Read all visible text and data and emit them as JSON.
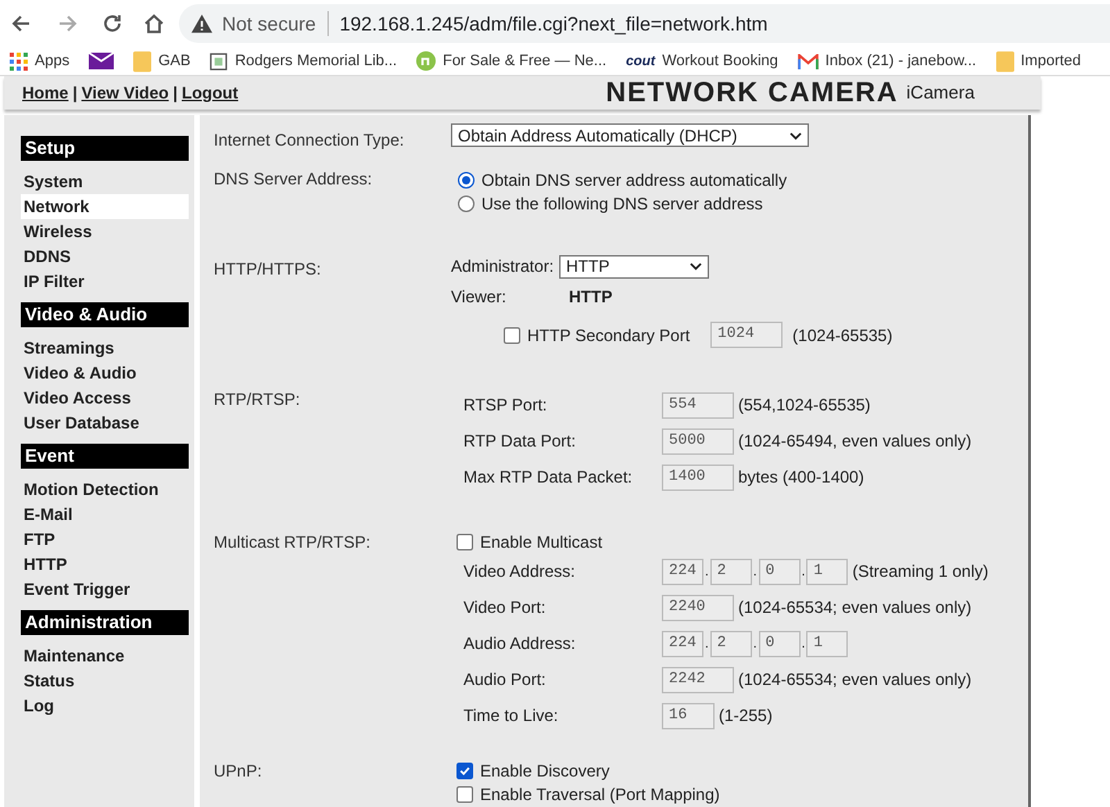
{
  "browser": {
    "security": "Not secure",
    "url": "192.168.1.245/adm/file.cgi?next_file=network.htm"
  },
  "bookmarks": [
    {
      "kind": "apps",
      "label": "Apps"
    },
    {
      "kind": "mail"
    },
    {
      "kind": "folder",
      "label": "GAB"
    },
    {
      "kind": "page",
      "label": "Rodgers Memorial Lib..."
    },
    {
      "kind": "circle",
      "label": "For Sale & Free — Ne..."
    },
    {
      "kind": "logo_text",
      "icon_text": "cout",
      "label": "Workout Booking"
    },
    {
      "kind": "gmail",
      "label": "Inbox (21) - janebow..."
    },
    {
      "kind": "folder",
      "label": "Imported"
    }
  ],
  "header": {
    "nav": [
      "Home",
      "View Video",
      "Logout"
    ],
    "separator": "|",
    "title": "NETWORK CAMERA",
    "subtitle": "iCamera"
  },
  "sidebar": [
    {
      "title": "Setup",
      "items": [
        {
          "label": "System",
          "selected": false
        },
        {
          "label": "Network",
          "selected": true
        },
        {
          "label": "Wireless",
          "selected": false
        },
        {
          "label": "DDNS",
          "selected": false
        },
        {
          "label": "IP Filter",
          "selected": false
        }
      ]
    },
    {
      "title": "Video & Audio",
      "items": [
        {
          "label": "Streamings",
          "selected": false
        },
        {
          "label": "Video & Audio",
          "selected": false
        },
        {
          "label": "Video Access",
          "selected": false
        },
        {
          "label": "User Database",
          "selected": false
        }
      ]
    },
    {
      "title": "Event",
      "items": [
        {
          "label": "Motion Detection",
          "selected": false
        },
        {
          "label": "E-Mail",
          "selected": false
        },
        {
          "label": "FTP",
          "selected": false
        },
        {
          "label": "HTTP",
          "selected": false
        },
        {
          "label": "Event Trigger",
          "selected": false
        }
      ]
    },
    {
      "title": "Administration",
      "items": [
        {
          "label": "Maintenance",
          "selected": false
        },
        {
          "label": "Status",
          "selected": false
        },
        {
          "label": "Log",
          "selected": false
        }
      ]
    }
  ],
  "sections": [
    {
      "label": "Internet Connection Type:",
      "controls": [
        {
          "kind": "select",
          "value": "Obtain Address Automatically (DHCP)"
        }
      ]
    },
    {
      "label": "DNS Server Address:",
      "controls": [
        {
          "kind": "radio",
          "label": "Obtain DNS server address automatically",
          "selected": true
        },
        {
          "kind": "radio",
          "label": "Use the following DNS server address",
          "selected": false
        }
      ]
    },
    {
      "label": "HTTP/HTTPS:",
      "controls": [
        {
          "kind": "labeled_select",
          "label": "Administrator:",
          "value": "HTTP"
        },
        {
          "kind": "labeled_text",
          "label": "Viewer:",
          "value": "HTTP"
        },
        {
          "kind": "check_field",
          "label": "HTTP Secondary Port",
          "checked": false,
          "value": "1024",
          "hint": "(1024-65535)"
        }
      ]
    },
    {
      "label": "RTP/RTSP:",
      "controls": [
        {
          "kind": "field",
          "label": "RTSP Port:",
          "value": "554",
          "hint": "(554,1024-65535)"
        },
        {
          "kind": "field",
          "label": "RTP Data Port:",
          "value": "5000",
          "hint": "(1024-65494, even values only)"
        },
        {
          "kind": "field",
          "label": "Max RTP Data Packet:",
          "value": "1400",
          "hint": "bytes (400-1400)"
        }
      ]
    },
    {
      "label": "Multicast RTP/RTSP:",
      "controls": [
        {
          "kind": "checkbox",
          "label": "Enable Multicast",
          "checked": false
        },
        {
          "kind": "ip",
          "label": "Video Address:",
          "octets": [
            "224",
            "2",
            "0",
            "1"
          ],
          "separator": ".",
          "hint": "(Streaming 1 only)"
        },
        {
          "kind": "field",
          "label": "Video Port:",
          "value": "2240",
          "hint": "(1024-65534; even values only)"
        },
        {
          "kind": "ip",
          "label": "Audio Address:",
          "octets": [
            "224",
            "2",
            "0",
            "1"
          ],
          "separator": "."
        },
        {
          "kind": "field",
          "label": "Audio Port:",
          "value": "2242",
          "hint": "(1024-65534; even values only)"
        },
        {
          "kind": "short_field",
          "label": "Time to Live:",
          "value": "16",
          "hint": "(1-255)"
        }
      ]
    },
    {
      "label": "UPnP:",
      "controls": [
        {
          "kind": "checkbox",
          "label": "Enable Discovery",
          "checked": true
        },
        {
          "kind": "checkbox",
          "label": "Enable Traversal (Port Mapping)",
          "checked": false
        }
      ]
    }
  ]
}
